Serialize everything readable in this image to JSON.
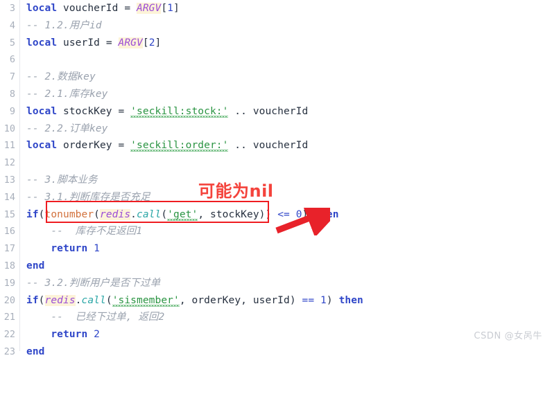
{
  "editor": {
    "language": "lua",
    "background_color": "#ffffff",
    "gutter_rule_color": "#e6e8ec",
    "first_line_number": 3,
    "last_line_number": 23,
    "line_numbers": [
      "3",
      "4",
      "5",
      "6",
      "7",
      "8",
      "9",
      "10",
      "11",
      "12",
      "13",
      "14",
      "15",
      "16",
      "17",
      "18",
      "19",
      "20",
      "21",
      "22",
      "23"
    ],
    "lines": [
      {
        "n": "3",
        "text": "local voucherId = ARGV[1]"
      },
      {
        "n": "4",
        "text": "-- 1.2.用户id"
      },
      {
        "n": "5",
        "text": "local userId = ARGV[2]"
      },
      {
        "n": "6",
        "text": ""
      },
      {
        "n": "7",
        "text": "-- 2.数据key"
      },
      {
        "n": "8",
        "text": "-- 2.1.库存key"
      },
      {
        "n": "9",
        "text": "local stockKey = 'seckill:stock:' .. voucherId"
      },
      {
        "n": "10",
        "text": "-- 2.2.订单key"
      },
      {
        "n": "11",
        "text": "local orderKey = 'seckill:order:' .. voucherId"
      },
      {
        "n": "12",
        "text": ""
      },
      {
        "n": "13",
        "text": "-- 3.脚本业务"
      },
      {
        "n": "14",
        "text": "-- 3.1.判断库存是否充足"
      },
      {
        "n": "15",
        "text": "if(tonumber(redis.call('get', stockKey)) <= 0) then"
      },
      {
        "n": "16",
        "text": "    --  库存不足返回1"
      },
      {
        "n": "17",
        "text": "    return 1"
      },
      {
        "n": "18",
        "text": "end"
      },
      {
        "n": "19",
        "text": "-- 3.2.判断用户是否下过单"
      },
      {
        "n": "20",
        "text": "if(redis.call('sismember', orderKey, userId) == 1) then"
      },
      {
        "n": "21",
        "text": "    --  已经下过单, 返回2"
      },
      {
        "n": "22",
        "text": "    return 2"
      },
      {
        "n": "23",
        "text": "end"
      }
    ],
    "tokens": {
      "keyword_local": "local",
      "keyword_if": "if",
      "keyword_then": "then",
      "keyword_return": "return",
      "keyword_end": "end",
      "global_argv": "ARGV",
      "function_tonumber": "tonumber",
      "object_redis": "redis",
      "method_call": "call",
      "string_stock_prefix": "'seckill:stock:'",
      "string_order_prefix": "'seckill:order:'",
      "string_get": "'get'",
      "string_sismember": "'sismember'",
      "var_voucherId": "voucherId",
      "var_userId": "userId",
      "var_stockKey": "stockKey",
      "var_orderKey": "orderKey",
      "operator_concat": "..",
      "operator_lte": "<=",
      "operator_eq": "==",
      "operator_assign": "=",
      "number_zero": "0",
      "number_one": "1",
      "number_two": "2",
      "index_one": "1",
      "index_two": "2"
    },
    "colors": {
      "keyword": "#2f46c8",
      "identifier": "#26303f",
      "string": "#2a9442",
      "comment": "#9aa2ae",
      "function": "#d2713c",
      "method": "#2aa6a6",
      "global": "#9b4dd6",
      "global_highlight_bg": "#fdf3d8",
      "number": "#2f46c8",
      "line_number": "#a8afbb"
    }
  },
  "annotation": {
    "label": "可能为nil",
    "label_color": "#f4433c",
    "box_color": "#ef1c21",
    "arrow_color": "#e8222a",
    "target_expression": "tonumber(redis.call('get', stockKey))"
  },
  "watermark": {
    "text": "CSDN @女呙牛",
    "color": "#c9ccd2"
  }
}
